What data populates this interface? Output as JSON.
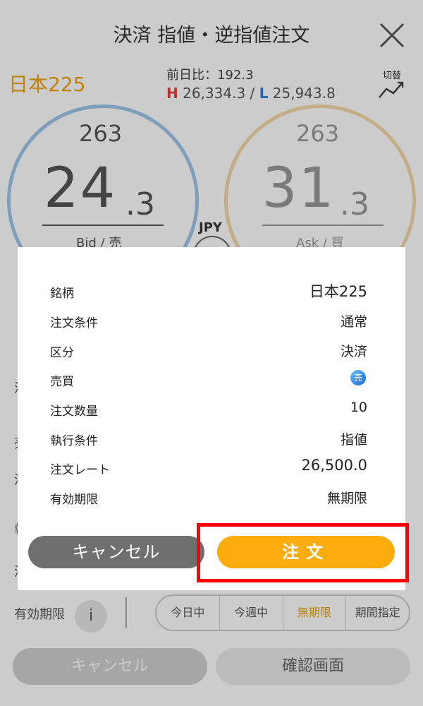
{
  "header": {
    "title": "決済 指値・逆指値注文",
    "close_icon": "close-icon"
  },
  "instrument": {
    "name": "日本225",
    "prev_label": "前日比：192.3",
    "high_label": "H",
    "high_value": "26,334.3",
    "separator": "/",
    "low_label": "L",
    "low_value": "25,943.8",
    "switch_label": "切替",
    "switch_icon": "chart-switch-icon"
  },
  "quotes": {
    "currency": "JPY",
    "bid": {
      "prefix": "263",
      "main": "24",
      "suffix": ".3",
      "label": "Bid / 売"
    },
    "ask": {
      "prefix": "263",
      "main": "31",
      "suffix": ".3",
      "label": "Ask / 買"
    }
  },
  "background_form": {
    "partial_labels": [
      "決",
      "売",
      "決",
      "執",
      "決"
    ],
    "expiry_label": "有効期限",
    "info_icon_text": "i",
    "period_options": [
      "今日中",
      "今週中",
      "無期限",
      "期間指定"
    ],
    "selected_period": "無期限",
    "cancel_label": "キャンセル",
    "confirm_label": "確認画面"
  },
  "modal": {
    "rows": [
      {
        "label": "銘柄",
        "value": "日本225"
      },
      {
        "label": "注文条件",
        "value": "通常"
      },
      {
        "label": "区分",
        "value": "決済"
      },
      {
        "label": "売買",
        "value": "売"
      },
      {
        "label": "注文数量",
        "value": "10"
      },
      {
        "label": "執行条件",
        "value": "指値"
      },
      {
        "label": "注文レート",
        "value": "26,500.0"
      },
      {
        "label": "有効期限",
        "value": "無期限"
      }
    ],
    "cancel_label": "キャンセル",
    "order_label": "注文"
  },
  "colors": {
    "accent": "#fbac0d",
    "highlight": "#ff0000",
    "bid": "#9fc6ea",
    "ask": "#f4d9a8",
    "sell_badge": "#1565d8"
  }
}
